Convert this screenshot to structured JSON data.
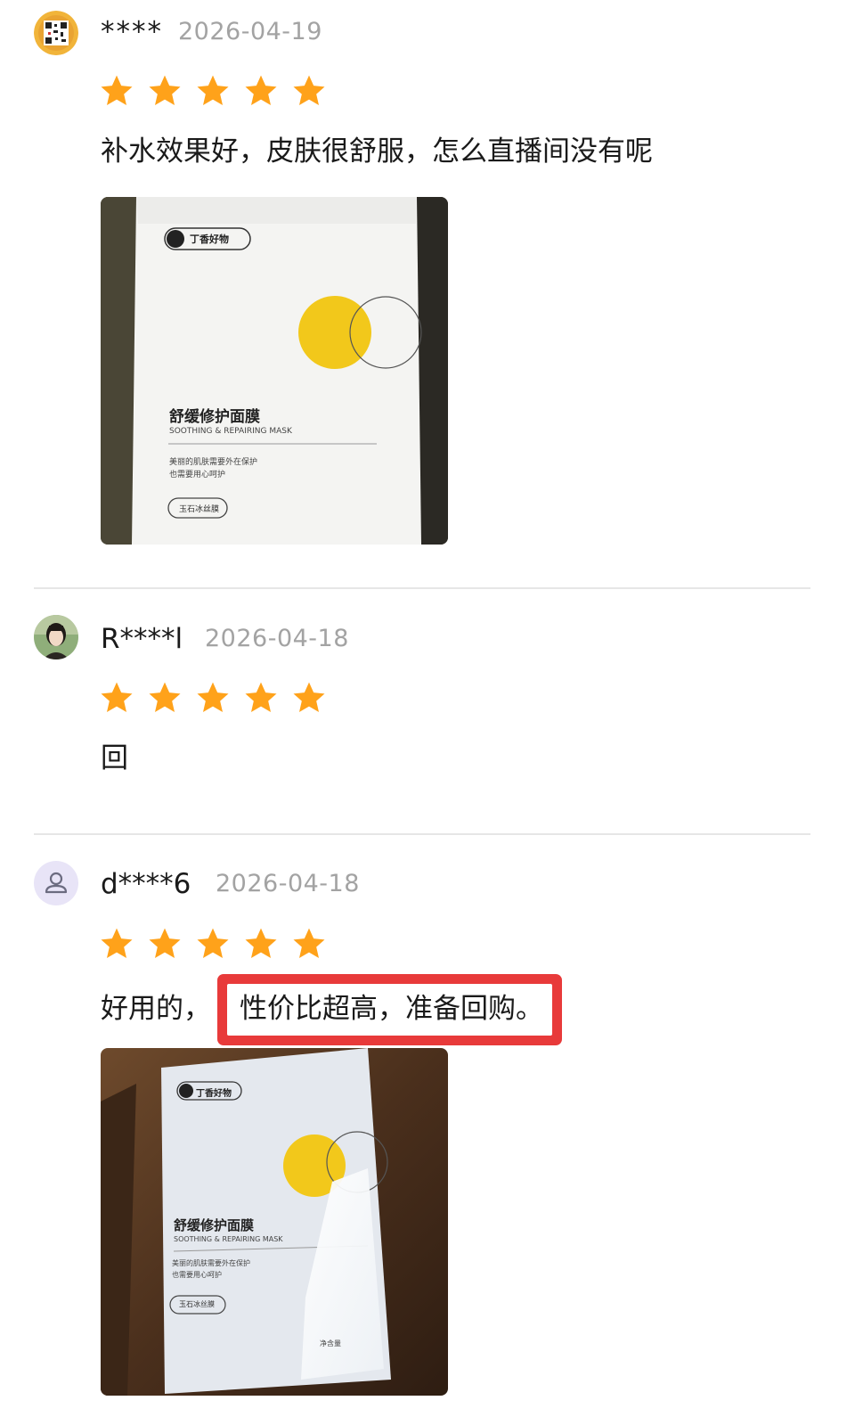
{
  "reviews": [
    {
      "username": "****",
      "date": "2026-04-19",
      "rating": 5,
      "text": "补水效果好，皮肤很舒服，怎么直播间没有呢",
      "avatar": "qr-pattern-avatar",
      "photo": {
        "brand": "丁香好物",
        "product_cn": "舒缓修护面膜",
        "product_en": "SOOTHING & REPAIRING MASK",
        "tagline_1": "美丽的肌肤需要外在保护",
        "tagline_2": "也需要用心呵护",
        "material": "玉石冰丝膜"
      }
    },
    {
      "username": "R****l",
      "date": "2026-04-18",
      "rating": 5,
      "text": "回",
      "avatar": "photo-avatar"
    },
    {
      "username": "d****6",
      "date": "2026-04-18",
      "rating": 5,
      "text_prefix": "好用的，",
      "text_highlight": "性价比超高，准备回购。",
      "avatar": "user-silhouette-avatar",
      "photo": {
        "brand": "丁香好物",
        "product_cn": "舒缓修护面膜",
        "product_en": "SOOTHING & REPAIRING MASK",
        "tagline_1": "美丽的肌肤需要外在保护",
        "tagline_2": "也需要用心呵护",
        "material": "玉石冰丝膜",
        "footer": "净含量"
      }
    }
  ],
  "colors": {
    "star": "#FFA21A",
    "date": "#A3A3A3",
    "divider": "#E6E6E6",
    "highlight_border": "#E83A3A",
    "brand_yellow": "#F2C81B"
  }
}
